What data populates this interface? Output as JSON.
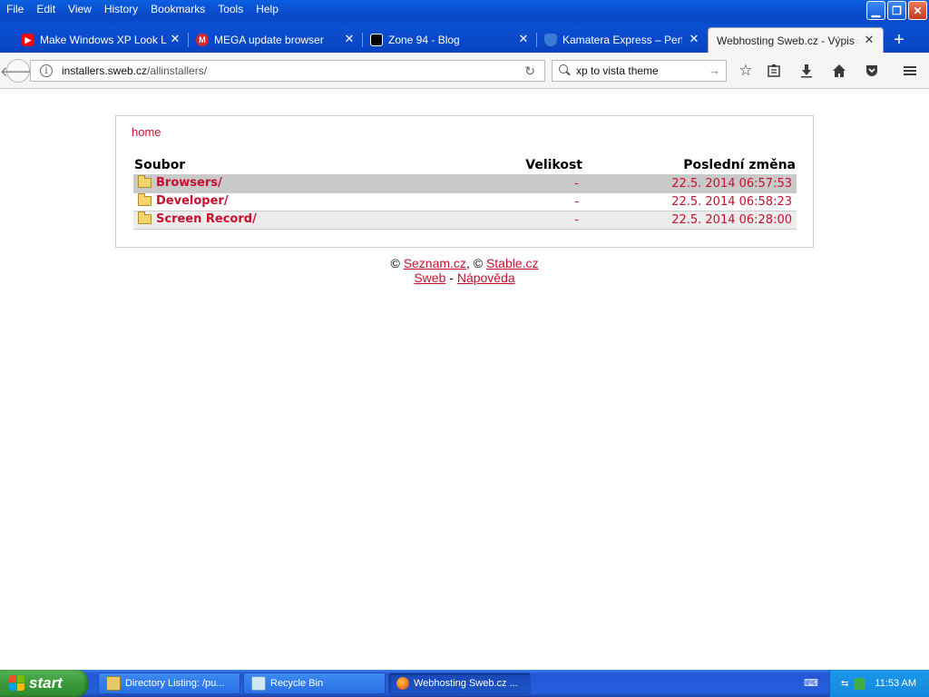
{
  "menubar": {
    "items": [
      "File",
      "Edit",
      "View",
      "History",
      "Bookmarks",
      "Tools",
      "Help"
    ]
  },
  "window_controls": {
    "icons": [
      "minimize-icon",
      "restore-icon",
      "close-icon"
    ]
  },
  "tabs": [
    {
      "title": "Make Windows XP Look Li...",
      "favicon": "youtube-icon",
      "favicon_color": "#ff0000",
      "active": false
    },
    {
      "title": "MEGA update browser",
      "favicon": "mega-icon",
      "favicon_color": "#d9272e",
      "active": false
    },
    {
      "title": "Zone 94 - Blog",
      "favicon": "zone94-icon",
      "favicon_color": "#000000",
      "active": false
    },
    {
      "title": "Kamatera Express – Perf...",
      "favicon": "kamatera-icon",
      "favicon_color": "#3a7bd5",
      "active": false
    },
    {
      "title": "Webhosting Sweb.cz - Výpis s...",
      "favicon": "",
      "favicon_color": "",
      "active": true
    }
  ],
  "navbar": {
    "url_host": "installers.sweb.cz",
    "url_path": "/allinstallers/",
    "search_value": "xp to vista theme"
  },
  "page": {
    "home_link": "home",
    "columns": {
      "name": "Soubor",
      "size": "Velikost",
      "modified": "Poslední změna"
    },
    "rows": [
      {
        "name": "Browsers/",
        "size": "-",
        "modified": "22.5. 2014 06:57:53"
      },
      {
        "name": "Developer/",
        "size": "-",
        "modified": "22.5. 2014 06:58:23"
      },
      {
        "name": "Screen Record/",
        "size": "-",
        "modified": "22.5. 2014 06:28:00"
      }
    ],
    "footer": {
      "copyright_symbol": "©",
      "seznam": "Seznam.cz",
      "stable": "Stable.cz",
      "sweb": "Sweb",
      "separator": "-",
      "help": "Nápověda"
    },
    "accent_color": "#c8102e"
  },
  "taskbar": {
    "start_label": "start",
    "tasks": [
      {
        "label": "Directory Listing: /pu...",
        "icon": "explorer-folder-icon",
        "active": false
      },
      {
        "label": "Recycle Bin",
        "icon": "recycle-bin-icon",
        "active": false
      },
      {
        "label": "Webhosting Sweb.cz ...",
        "icon": "firefox-icon",
        "active": true
      }
    ],
    "clock": "11:53 AM"
  }
}
